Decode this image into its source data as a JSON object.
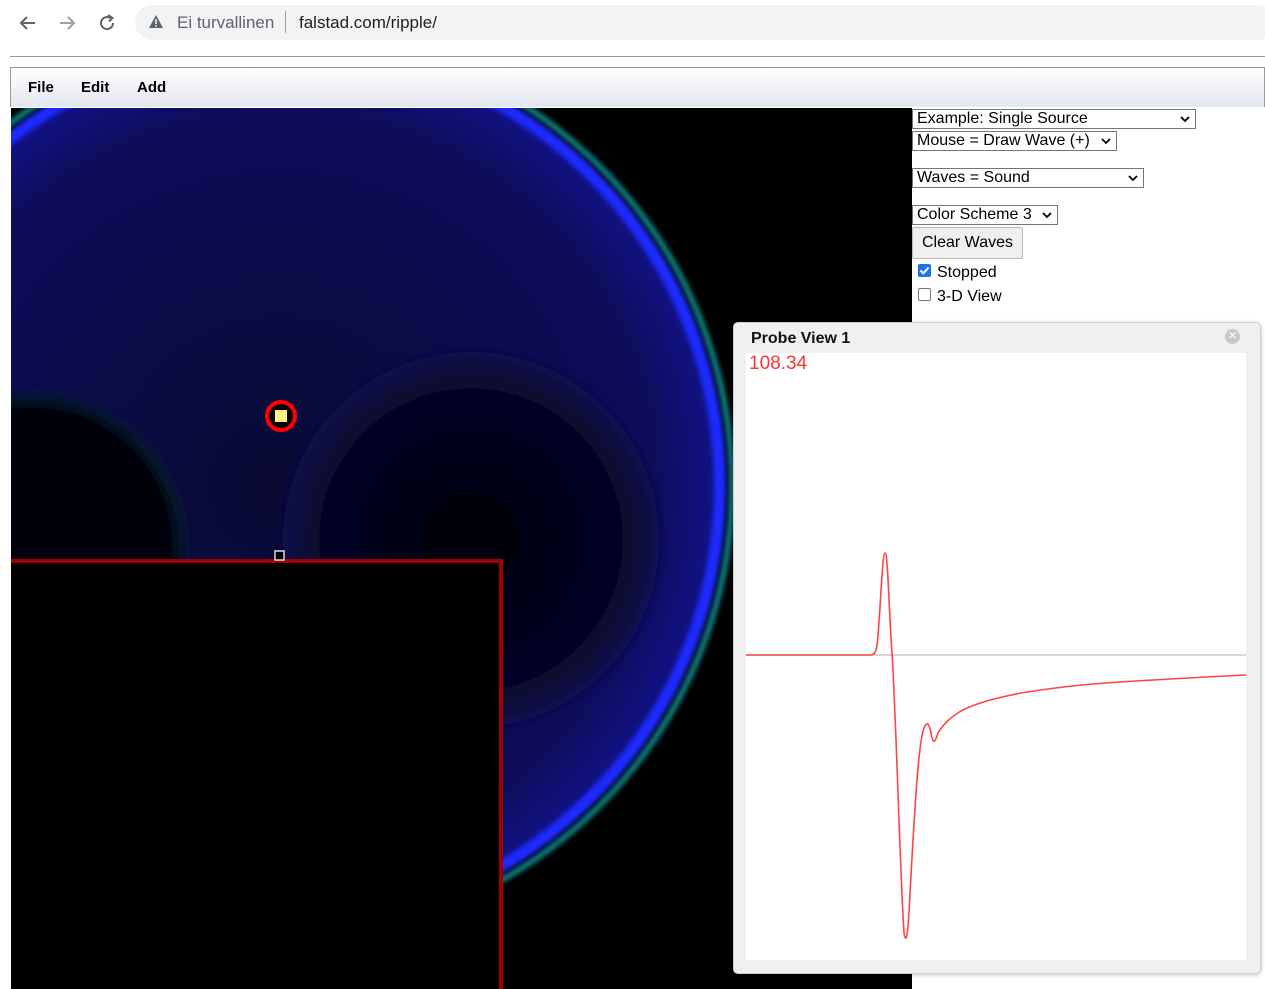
{
  "browser": {
    "security_text": "Ei turvallinen",
    "url": "falstad.com/ripple/"
  },
  "menu": {
    "items": [
      "File",
      "Edit",
      "Add"
    ]
  },
  "controls": {
    "example_select": "Example: Single Source",
    "mouse_select": "Mouse = Draw Wave (+)",
    "waves_select": "Waves = Sound",
    "color_scheme_select": "Color Scheme 3",
    "clear_button": "Clear Waves",
    "stopped_label": "Stopped",
    "stopped_checked": true,
    "view3d_label": "3-D View",
    "view3d_checked": false
  },
  "probe": {
    "title": "Probe View 1",
    "value": "108.34",
    "colors": {
      "trace": "#ff4444",
      "baseline": "#c8c8c8",
      "value": "#ff3333"
    }
  },
  "canvas": {
    "colors": {
      "wave": "#1a2bff",
      "rim": "#0e7f7f",
      "wall": "#a00000",
      "source_ring": "#ff0000",
      "source_fill": "#ffee88"
    }
  }
}
